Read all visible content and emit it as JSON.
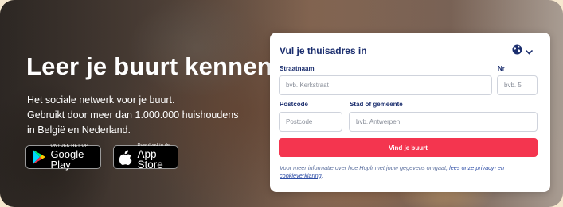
{
  "hero": {
    "headline": "Leer je buurt kennen",
    "sub_lines": [
      "Het sociale netwerk voor je buurt.",
      "Gebruikt door meer dan 1.000.000 huishoudens",
      "in België en Nederland."
    ],
    "google_play": {
      "small": "ONTDEK HET OP",
      "big": "Google Play",
      "icon": "google-play-icon"
    },
    "app_store": {
      "small": "Download in de",
      "big": "App Store",
      "icon": "apple-icon"
    }
  },
  "form": {
    "title": "Vul je thuisadres in",
    "language_icon": "globe-icon",
    "street": {
      "label": "Straatnaam",
      "placeholder": "bvb. Kerkstraat"
    },
    "number": {
      "label": "Nr",
      "placeholder": "bvb. 5"
    },
    "postcode": {
      "label": "Postcode",
      "placeholder": "Postcode"
    },
    "city": {
      "label": "Stad of gemeente",
      "placeholder": "bvb. Antwerpen"
    },
    "submit_label": "Vind je buurt",
    "privacy_text": "Voor meer informatie over hoe Hoplr met jouw gegevens omgaat, ",
    "privacy_link": "lees onze privacy- en cookieverklaring",
    "privacy_end": "."
  },
  "colors": {
    "brand_navy": "#1b2e6e",
    "accent_red": "#f4354f",
    "page_bg": "#f6e8cf"
  }
}
